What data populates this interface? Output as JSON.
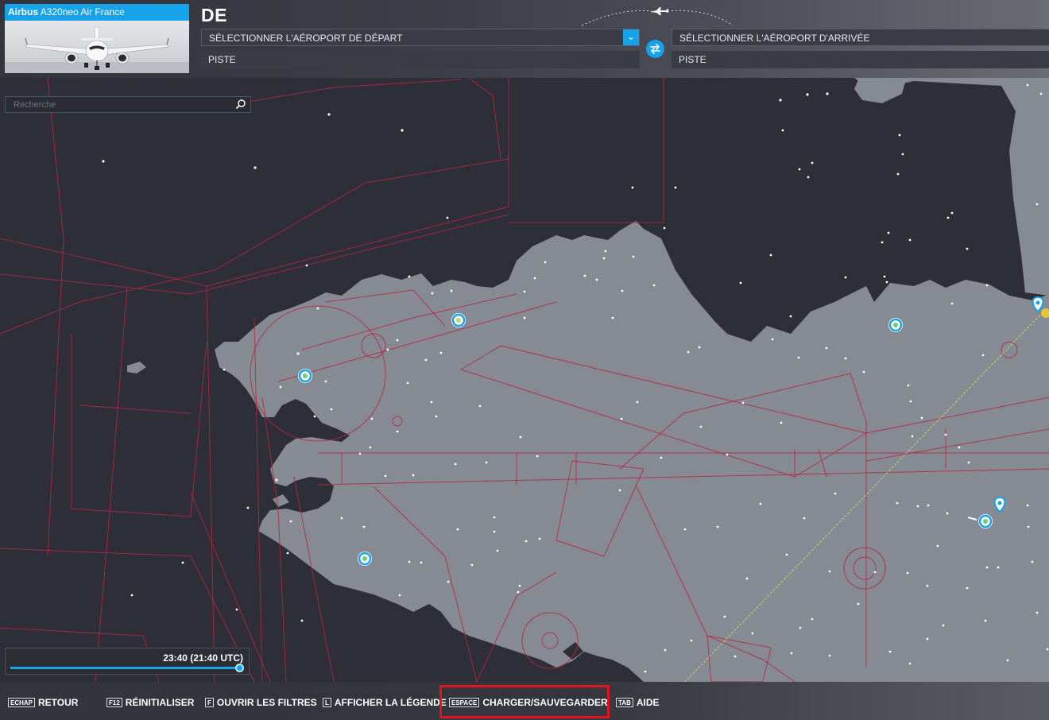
{
  "aircraft": {
    "brand": "Airbus",
    "model": "A320neo Air France"
  },
  "route": {
    "heading": "DE",
    "departure_select": "SÉLECTIONNER L'AÉROPORT DE DÉPART",
    "departure_runway": "PISTE",
    "arrival_select": "SÉLECTIONNER L'AÉROPORT D'ARRIVÉE",
    "arrival_runway": "PISTE"
  },
  "search": {
    "placeholder": "Recherche",
    "value": ""
  },
  "time": {
    "label": "23:40 (21:40 UTC)",
    "slider_fraction": 1.0
  },
  "shortcuts": [
    {
      "key": "ECHAP",
      "label": "RETOUR"
    },
    {
      "key": "F12",
      "label": "RÉINITIALISER"
    },
    {
      "key": "F",
      "label": "OUVRIR LES FILTRES"
    },
    {
      "key": "L",
      "label": "AFFICHER LA LÉGENDE"
    },
    {
      "key": "ESPACE",
      "label": "CHARGER/SAUVEGARDER"
    },
    {
      "key": "TAB",
      "label": "AIDE"
    }
  ],
  "icons": {
    "dropdown": "chevron-down-icon",
    "swap": "swap-icon",
    "search": "search-icon",
    "airport": "airport-marker-icon",
    "pin": "location-pin-icon"
  },
  "colors": {
    "accent": "#16a3ea",
    "land": "#8a8e98",
    "sea": "#2d2e37",
    "airspace": "#b4283f",
    "flight_path": "#c9d36a",
    "highlight": "#e0141b"
  }
}
